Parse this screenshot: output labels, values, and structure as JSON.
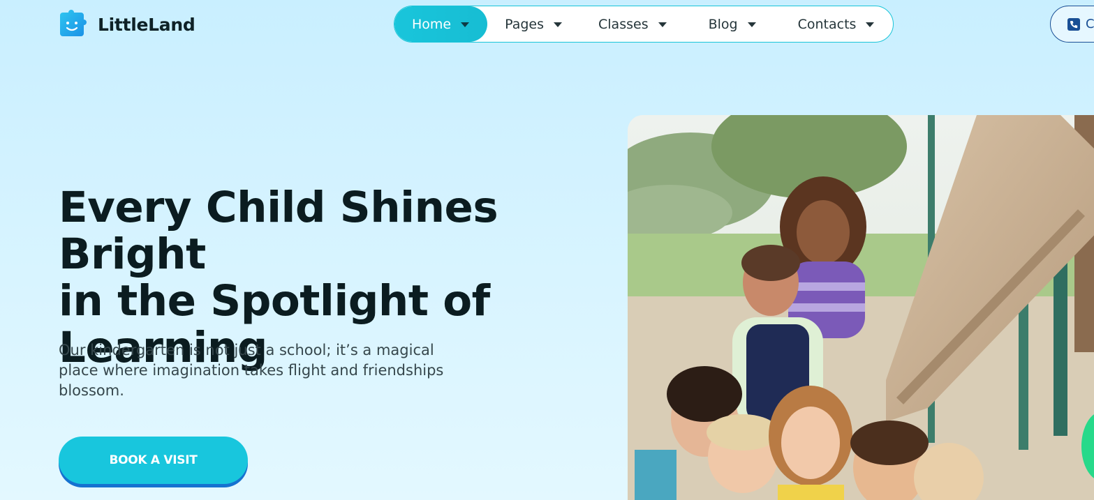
{
  "brand": {
    "name": "LittleLand"
  },
  "nav": {
    "items": [
      {
        "label": "Home",
        "active": true
      },
      {
        "label": "Pages"
      },
      {
        "label": "Classes"
      },
      {
        "label": "Blog"
      },
      {
        "label": "Contacts"
      }
    ]
  },
  "header": {
    "phone_label": "C"
  },
  "hero": {
    "title_line1": "Every Child Shines Bright",
    "title_line2": "in the Spotlight of",
    "title_line3": "Learning",
    "description": "Our kindergarten is not just a school; it’s a magical place where imagination takes flight and friendships blossom.",
    "cta_label": "BOOK A VISIT"
  },
  "colors": {
    "accent": "#18c6dd",
    "cta_shadow": "#1572d0",
    "background": "#c9efff",
    "heading": "#0b1c20",
    "phone_border": "#1a4f95"
  },
  "icons": {
    "logo": "smiling-puzzle-icon",
    "phone": "phone-icon",
    "dropdown": "caret-down-icon"
  }
}
